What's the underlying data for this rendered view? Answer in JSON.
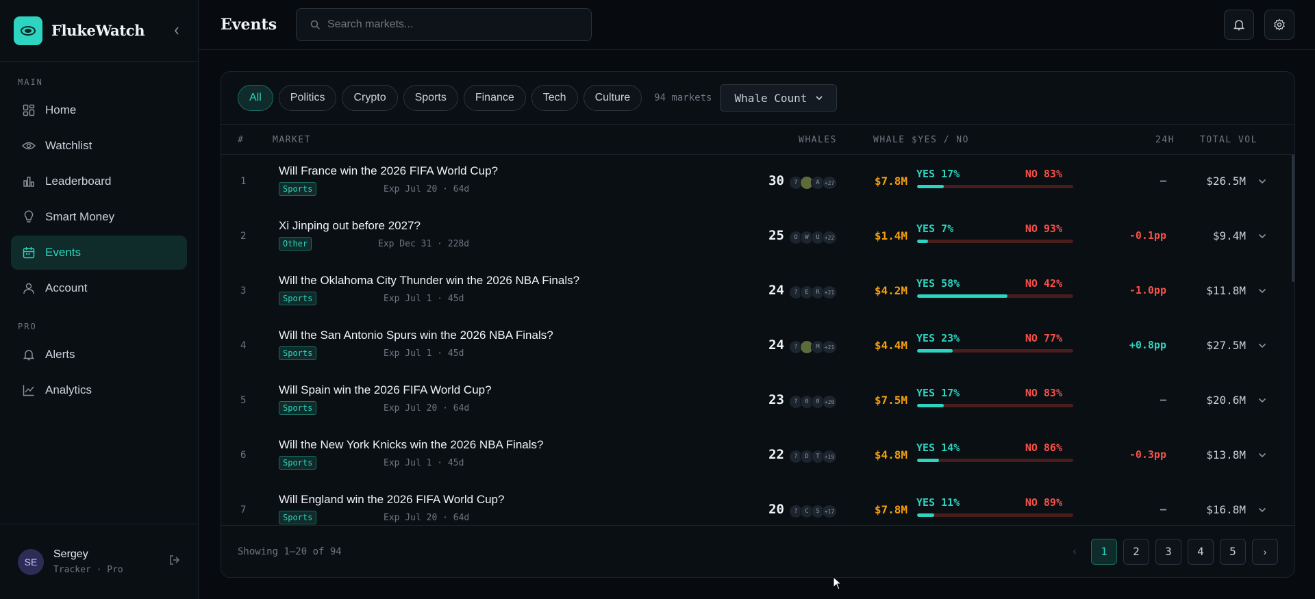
{
  "app": {
    "name": "FlukeWatch"
  },
  "sidebar": {
    "section_main": "MAIN",
    "section_pro": "PRO",
    "main_items": [
      {
        "label": "Home",
        "icon": "grid-icon"
      },
      {
        "label": "Watchlist",
        "icon": "eye-icon"
      },
      {
        "label": "Leaderboard",
        "icon": "bar-chart-icon"
      },
      {
        "label": "Smart Money",
        "icon": "lightbulb-icon"
      },
      {
        "label": "Events",
        "icon": "calendar-icon",
        "active": true
      },
      {
        "label": "Account",
        "icon": "user-icon"
      }
    ],
    "pro_items": [
      {
        "label": "Alerts",
        "icon": "bell-icon"
      },
      {
        "label": "Analytics",
        "icon": "line-chart-icon"
      }
    ],
    "user": {
      "initials": "SE",
      "name": "Sergey",
      "role": "Tracker · Pro"
    }
  },
  "header": {
    "title": "Events",
    "search_placeholder": "Search markets..."
  },
  "filters": {
    "chips": [
      "All",
      "Politics",
      "Crypto",
      "Sports",
      "Finance",
      "Tech",
      "Culture"
    ],
    "active": "All",
    "count": "94 markets",
    "sort": "Whale Count"
  },
  "table": {
    "headers": {
      "num": "#",
      "market": "MARKET",
      "whales": "WHALES",
      "split": "WHALE $YES / NO",
      "change": "24H",
      "volume": "TOTAL VOL"
    },
    "rows": [
      {
        "num": "1",
        "title": "Will France win the 2026 FIFA World Cup?",
        "tag": "Sports",
        "exp": "Exp Jul 20 · 64d",
        "whales": "30",
        "avatars": [
          "?",
          "img",
          "A"
        ],
        "more": "+27",
        "whale_amt": "$7.8M",
        "yes": "YES 17%",
        "no": "NO 83%",
        "yes_pct": 17,
        "change": "—",
        "change_dir": "flat",
        "volume": "$26.5M"
      },
      {
        "num": "2",
        "title": "Xi Jinping out before 2027?",
        "tag": "Other",
        "exp": "Exp Dec 31 · 228d",
        "whales": "25",
        "avatars": [
          "O",
          "W",
          "U"
        ],
        "more": "+22",
        "whale_amt": "$1.4M",
        "yes": "YES 7%",
        "no": "NO 93%",
        "yes_pct": 7,
        "change": "-0.1pp",
        "change_dir": "down",
        "volume": "$9.4M"
      },
      {
        "num": "3",
        "title": "Will the Oklahoma City Thunder win the 2026 NBA Finals?",
        "tag": "Sports",
        "exp": "Exp Jul 1 · 45d",
        "whales": "24",
        "avatars": [
          "?",
          "E",
          "R"
        ],
        "more": "+21",
        "whale_amt": "$4.2M",
        "yes": "YES 58%",
        "no": "NO 42%",
        "yes_pct": 58,
        "change": "-1.0pp",
        "change_dir": "down",
        "volume": "$11.8M"
      },
      {
        "num": "4",
        "title": "Will the San Antonio Spurs win the 2026 NBA Finals?",
        "tag": "Sports",
        "exp": "Exp Jul 1 · 45d",
        "whales": "24",
        "avatars": [
          "?",
          "img",
          "M"
        ],
        "more": "+21",
        "whale_amt": "$4.4M",
        "yes": "YES 23%",
        "no": "NO 77%",
        "yes_pct": 23,
        "change": "+0.8pp",
        "change_dir": "up",
        "volume": "$27.5M"
      },
      {
        "num": "5",
        "title": "Will Spain win the 2026 FIFA World Cup?",
        "tag": "Sports",
        "exp": "Exp Jul 20 · 64d",
        "whales": "23",
        "avatars": [
          "?",
          "0",
          "0"
        ],
        "more": "+20",
        "whale_amt": "$7.5M",
        "yes": "YES 17%",
        "no": "NO 83%",
        "yes_pct": 17,
        "change": "—",
        "change_dir": "flat",
        "volume": "$20.6M"
      },
      {
        "num": "6",
        "title": "Will the New York Knicks win the 2026 NBA Finals?",
        "tag": "Sports",
        "exp": "Exp Jul 1 · 45d",
        "whales": "22",
        "avatars": [
          "?",
          "D",
          "T"
        ],
        "more": "+19",
        "whale_amt": "$4.8M",
        "yes": "YES 14%",
        "no": "NO 86%",
        "yes_pct": 14,
        "change": "-0.3pp",
        "change_dir": "down",
        "volume": "$13.8M"
      },
      {
        "num": "7",
        "title": "Will England win the 2026 FIFA World Cup?",
        "tag": "Sports",
        "exp": "Exp Jul 20 · 64d",
        "whales": "20",
        "avatars": [
          "?",
          "C",
          "S"
        ],
        "more": "+17",
        "whale_amt": "$7.8M",
        "yes": "YES 11%",
        "no": "NO 89%",
        "yes_pct": 11,
        "change": "—",
        "change_dir": "flat",
        "volume": "$16.8M"
      }
    ]
  },
  "footer": {
    "showing": "Showing 1–20 of 94",
    "pages": [
      "1",
      "2",
      "3",
      "4",
      "5"
    ],
    "current": "1",
    "prev": "‹",
    "next": "›"
  },
  "colors": {
    "accent": "#2dd4bf",
    "negative": "#f85149",
    "amount": "#f59e0b",
    "bg": "#070b0f"
  }
}
